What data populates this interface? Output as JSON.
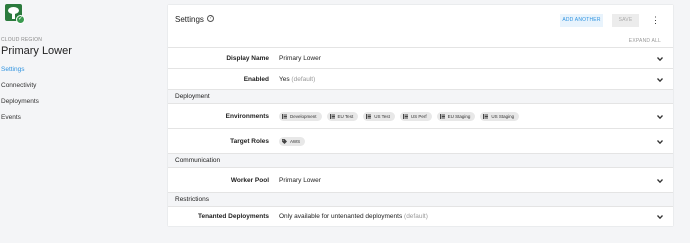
{
  "sidebar": {
    "breadcrumb": "CLOUD REGION",
    "title": "Primary Lower",
    "nav": [
      {
        "label": "Settings",
        "active": true
      },
      {
        "label": "Connectivity",
        "active": false
      },
      {
        "label": "Deployments",
        "active": false
      },
      {
        "label": "Events",
        "active": false
      }
    ]
  },
  "panel": {
    "title": "Settings",
    "add_another": "ADD ANOTHER",
    "save": "SAVE",
    "expand_all": "EXPAND ALL",
    "display_name_label": "Display Name",
    "display_name_value": "Primary Lower",
    "enabled_label": "Enabled",
    "enabled_value": "Yes",
    "enabled_default": "(default)",
    "deployment_section": "Deployment",
    "environments_label": "Environments",
    "environments": [
      "Development",
      "EU Test",
      "US Test",
      "US Perf",
      "EU Staging",
      "US Staging"
    ],
    "target_roles_label": "Target Roles",
    "target_roles": [
      "AWS"
    ],
    "communication_section": "Communication",
    "worker_pool_label": "Worker Pool",
    "worker_pool_value": "Primary Lower",
    "restrictions_section": "Restrictions",
    "tenanted_label": "Tenanted Deployments",
    "tenanted_value": "Only available for untenanted deployments",
    "tenanted_default": "(default)"
  },
  "colors": {
    "accent": "#2f93e0",
    "logo": "#2b7a3d"
  }
}
